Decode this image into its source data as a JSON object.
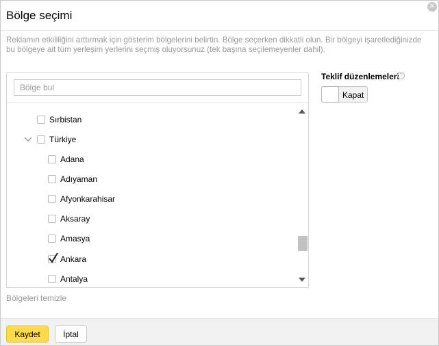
{
  "dialog": {
    "title": "Bölge seçimi",
    "close_icon": "close-icon",
    "description": "Reklamın etkililiğini arttırmak için gösterim bölgelerini belirtin. Bölge seçerken dikkatli olun. Bir bölgeyi işaretlediğinizde bu bölgeye ait tüm yerleşim yerlerini seçmiş oluyorsunuz (tek başına seçilemeyenler dahil)."
  },
  "search": {
    "placeholder": "Bölge bul",
    "value": ""
  },
  "tree": {
    "items": [
      {
        "label": "Sırbistan",
        "checked": false
      },
      {
        "label": "Türkiye",
        "checked": false,
        "expanded": true
      },
      {
        "label": "Adana",
        "checked": false
      },
      {
        "label": "Adıyaman",
        "checked": false
      },
      {
        "label": "Afyonkarahisar",
        "checked": false
      },
      {
        "label": "Aksaray",
        "checked": false
      },
      {
        "label": "Amasya",
        "checked": false
      },
      {
        "label": "Ankara",
        "checked": true
      },
      {
        "label": "Antalya",
        "checked": false
      }
    ]
  },
  "clear_link": "Bölgeleri temizle",
  "bid_settings": {
    "title": "Teklif düzenlemeleri",
    "help_icon": "help-icon",
    "toggle_label": "Kapat"
  },
  "footer": {
    "save_label": "Kaydet",
    "cancel_label": "İptal"
  },
  "colors": {
    "save_button": "#ffdb4d",
    "footer_bg": "#f2f2f2",
    "muted_text": "#999999"
  }
}
